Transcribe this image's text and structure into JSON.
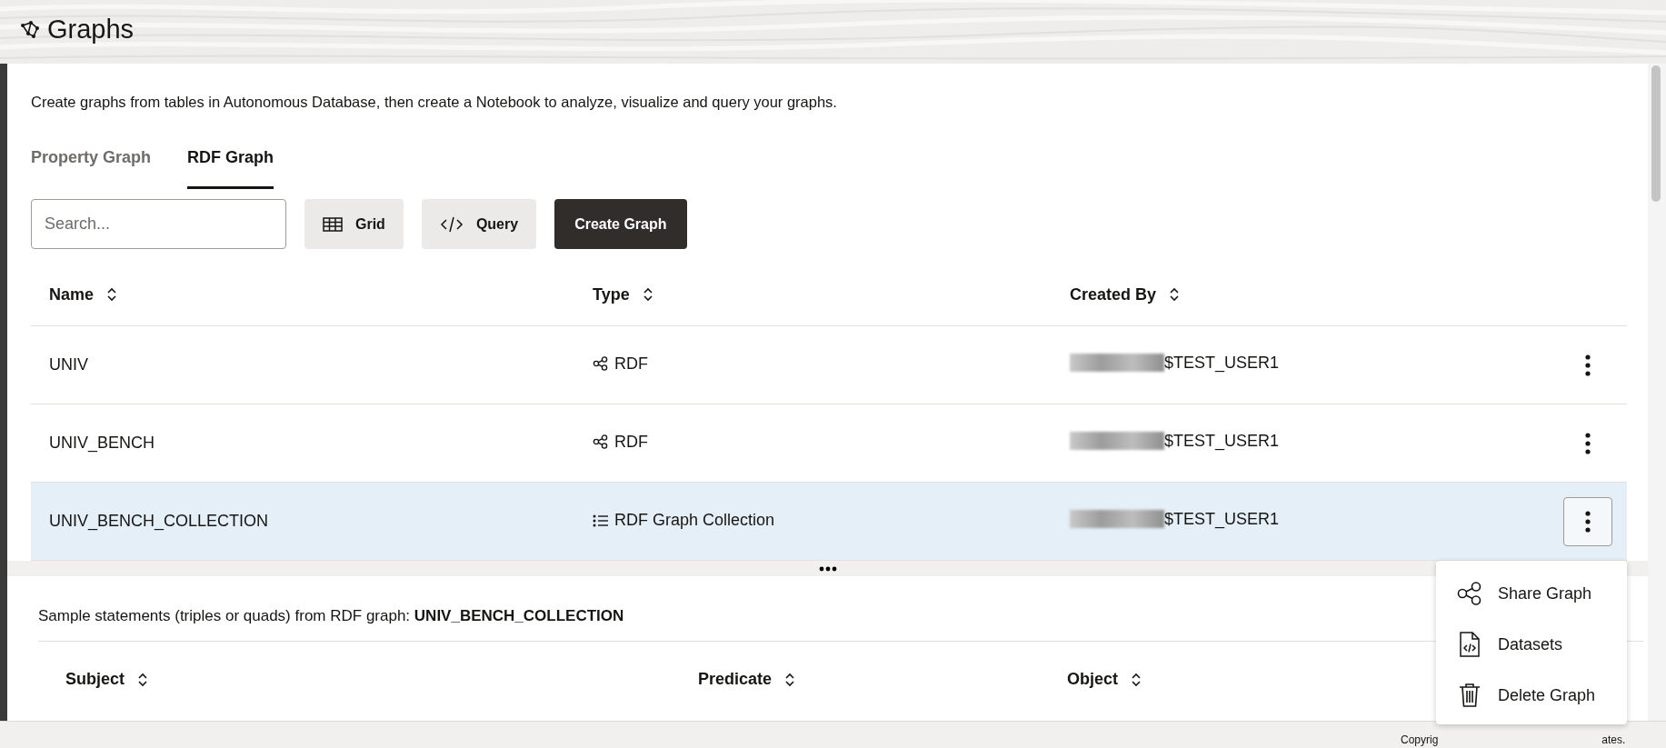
{
  "header": {
    "title": "Graphs"
  },
  "description": "Create graphs from tables in Autonomous Database, then create a Notebook to analyze, visualize and query your graphs.",
  "tabs": [
    {
      "label": "Property Graph",
      "selected": false
    },
    {
      "label": "RDF Graph",
      "selected": true
    }
  ],
  "search": {
    "placeholder": "Search..."
  },
  "toolbar": [
    {
      "label": "Grid",
      "kind": "grid"
    },
    {
      "label": "Query",
      "kind": "query"
    },
    {
      "label": "Create Graph",
      "kind": "primary"
    }
  ],
  "table": {
    "columns": [
      "Name",
      "Type",
      "Created By"
    ],
    "rows": [
      {
        "name": "UNIV",
        "type": "RDF",
        "kind": "graph",
        "created_by": "$TEST_USER1",
        "selected": false
      },
      {
        "name": "UNIV_BENCH",
        "type": "RDF",
        "kind": "graph",
        "created_by": "$TEST_USER1",
        "selected": false
      },
      {
        "name": "UNIV_BENCH_COLLECTION",
        "type": "RDF Graph Collection",
        "kind": "collection",
        "created_by": "$TEST_USER1",
        "selected": true
      }
    ]
  },
  "lower": {
    "caption": "Sample statements (triples or quads) from RDF graph: **UNIV_BENCH_COLLECTION**",
    "columns": [
      "Subject",
      "Predicate",
      "Object"
    ]
  },
  "menu": {
    "items": [
      {
        "label": "Share Graph",
        "kind": "share"
      },
      {
        "label": "Datasets",
        "kind": "datasets"
      },
      {
        "label": "Delete Graph",
        "kind": "delete"
      }
    ]
  },
  "footer": [
    "Copyrig",
    "ates."
  ]
}
